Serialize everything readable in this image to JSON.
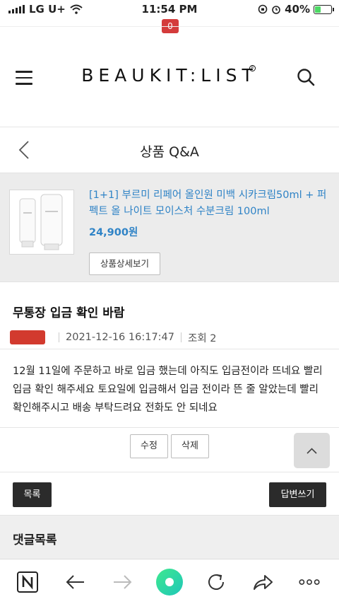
{
  "status_bar": {
    "carrier": "LG U+",
    "time": "11:54 PM",
    "battery": "40%",
    "battery_level": 0.4
  },
  "header": {
    "logo": "BEAUKIT:LIST",
    "cart_count": "0",
    "menu_icon": "hamburger-icon",
    "search_icon": "search-icon"
  },
  "page": {
    "title": "상품 Q&A",
    "back_icon": "chevron-left-icon"
  },
  "product": {
    "name": "[1+1] 부르미 리페어 올인원 미백 시카크림50ml + 퍼펙트 올 나이트 모이스처 수분크림 100ml",
    "price": "24,900원",
    "detail_button": "상품상세보기"
  },
  "post": {
    "title": "무통장 입금 확인 바람",
    "datetime": "2021-12-16 16:17:47",
    "views": "조회 2",
    "body": "12월 11일에 주문하고 바로 입금 했는데 아직도 입금전이라 뜨네요 빨리 입금 확인 해주세요 토요일에 입금해서 입금 전이라 뜬 줄 알았는데 빨리 확인해주시고 배송 부탁드려요 전화도 안 되네요"
  },
  "actions": {
    "edit": "수정",
    "delete": "삭제",
    "list": "목록",
    "reply": "답변쓰기"
  },
  "comments": {
    "title": "댓글목록"
  },
  "colors": {
    "link_blue": "#2f83c6",
    "badge_red": "#d43b3b",
    "dark_button": "#2b2b2b"
  }
}
